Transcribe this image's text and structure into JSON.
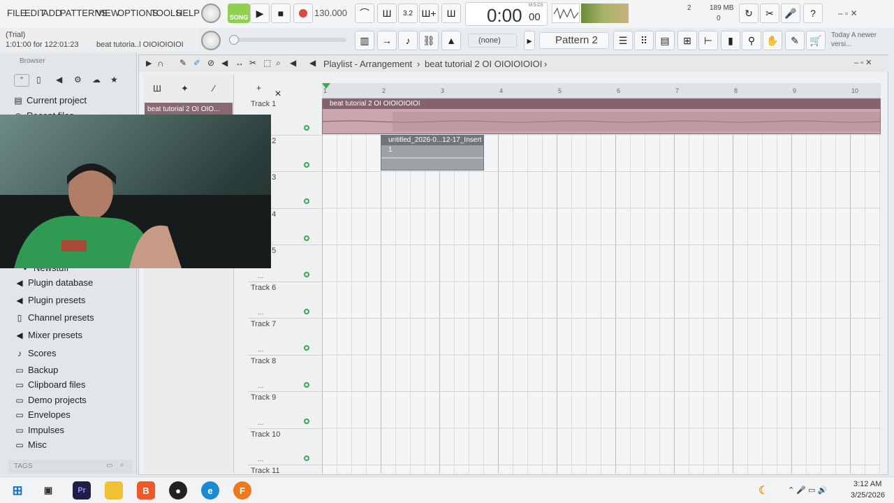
{
  "menu": [
    "FILE",
    "EDIT",
    "ADD",
    "PATTERNS",
    "VIEW",
    "OPTIONS",
    "TOOLS",
    "HELP"
  ],
  "hint": {
    "line1": "(Trial)",
    "line2": "1:01:00 for 122:01:23",
    "project": "beat tutoria..l OIOIOIOIOI"
  },
  "transport": {
    "mode": "SONG",
    "tempo": "130.000",
    "time": "0:00",
    "time_small": "00",
    "time_unit": "M:S:CS"
  },
  "monitor": {
    "cpu": "2",
    "mem": "189 MB",
    "mem2": "0"
  },
  "toolbar": {
    "pattern": "Pattern 2",
    "snap": "(none)",
    "news": "Today  A newer versi..."
  },
  "browser": {
    "title": "Browser",
    "items": [
      {
        "label": "Current project",
        "icon": "project-icon"
      },
      {
        "label": "Recent files",
        "icon": "recent-icon"
      },
      {
        "label": "Newstuff",
        "icon": "folder-icon"
      },
      {
        "label": "Plugin database",
        "icon": "plugin-icon"
      },
      {
        "label": "Plugin presets",
        "icon": "plugin-icon"
      },
      {
        "label": "Channel presets",
        "icon": "channel-icon"
      },
      {
        "label": "Mixer presets",
        "icon": "mixer-icon"
      },
      {
        "label": "Scores",
        "icon": "note-icon"
      },
      {
        "label": "Backup",
        "icon": "folder-icon"
      },
      {
        "label": "Clipboard files",
        "icon": "folder-icon"
      },
      {
        "label": "Demo projects",
        "icon": "folder-icon"
      },
      {
        "label": "Envelopes",
        "icon": "folder-icon"
      },
      {
        "label": "Impulses",
        "icon": "folder-icon"
      },
      {
        "label": "Misc",
        "icon": "folder-icon"
      }
    ],
    "tags": "TAGS"
  },
  "playlist": {
    "title": "Playlist - Arrangement",
    "arrangement": "beat tutorial 2 OI OIOIOIOIOI",
    "pattern_item": "beat tutorial 2 OI OIO...",
    "ruler": [
      "1",
      "2",
      "3",
      "4",
      "5",
      "6",
      "7",
      "8",
      "9",
      "10"
    ],
    "tracks": [
      "Track 1",
      "Track 2",
      "Track 3",
      "Track 4",
      "Track 5",
      "Track 6",
      "Track 7",
      "Track 8",
      "Track 9",
      "Track 10",
      "Track 11"
    ],
    "clips": [
      {
        "name": "beat tutorial 2 OI OIOIOIOIOI"
      },
      {
        "name": "untitled_2026-0...12-17_Insert 1"
      }
    ]
  },
  "taskbar": {
    "time": "3:12 AM",
    "date": "3/25/2026"
  },
  "colors": {
    "clip": "#c9a6ae",
    "clip_head": "#86636c",
    "accent_green": "#3ca65a",
    "record": "#e0483e"
  }
}
